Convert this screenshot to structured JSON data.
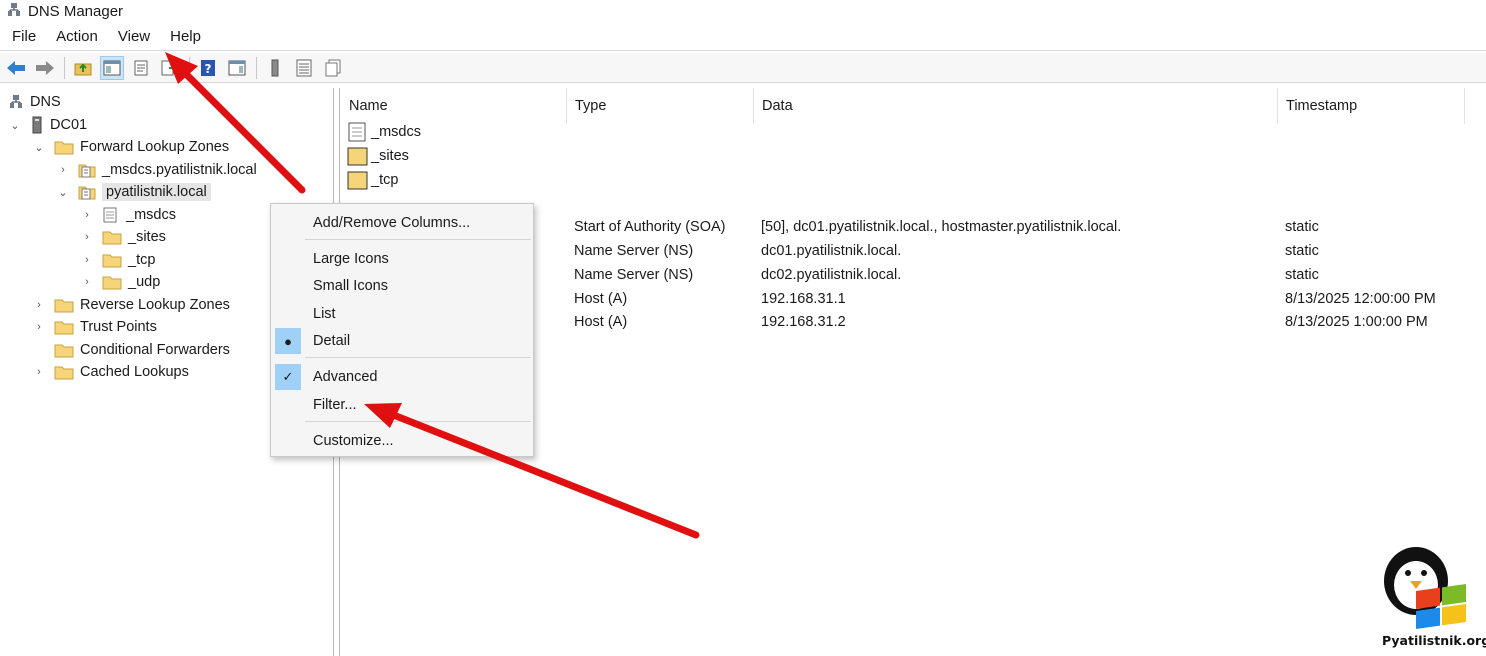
{
  "window": {
    "title": "DNS Manager"
  },
  "menu": [
    "File",
    "Action",
    "View",
    "Help"
  ],
  "tree": {
    "root": "DNS",
    "server": "DC01",
    "forward_zones": "Forward Lookup Zones",
    "msdcs_zone": "_msdcs.pyatilistnik.local",
    "zone": "pyatilistnik.local",
    "zone_children": [
      "_msdcs",
      "_sites",
      "_tcp",
      "_udp"
    ],
    "reverse_zones": "Reverse Lookup Zones",
    "trust_points": "Trust Points",
    "conditional_forwarders": "Conditional Forwarders",
    "cached_lookups": "Cached Lookups"
  },
  "columns": [
    "Name",
    "Type",
    "Data",
    "Timestamp"
  ],
  "folders": [
    "_msdcs",
    "_sites",
    "_tcp"
  ],
  "records": [
    {
      "type": "Start of Authority (SOA)",
      "data": "[50], dc01.pyatilistnik.local., hostmaster.pyatilistnik.local.",
      "timestamp": "static"
    },
    {
      "type": "Name Server (NS)",
      "data": "dc01.pyatilistnik.local.",
      "timestamp": "static"
    },
    {
      "type": "Name Server (NS)",
      "data": "dc02.pyatilistnik.local.",
      "timestamp": "static"
    },
    {
      "type": "Host (A)",
      "data": "192.168.31.1",
      "timestamp": "8/13/2025 12:00:00 PM"
    },
    {
      "type": "Host (A)",
      "data": "192.168.31.2",
      "timestamp": "8/13/2025 1:00:00 PM"
    }
  ],
  "context_menu": {
    "add_remove_columns": "Add/Remove Columns...",
    "large_icons": "Large Icons",
    "small_icons": "Small Icons",
    "list": "List",
    "detail": "Detail",
    "advanced": "Advanced",
    "filter": "Filter...",
    "customize": "Customize...",
    "detail_selected": true,
    "advanced_checked": true
  },
  "watermark": {
    "text": "Pyatilistnik.org"
  },
  "colors": {
    "arrow": "#e01010",
    "highlight": "#9fd0f5",
    "folder": "#f5d47a"
  }
}
